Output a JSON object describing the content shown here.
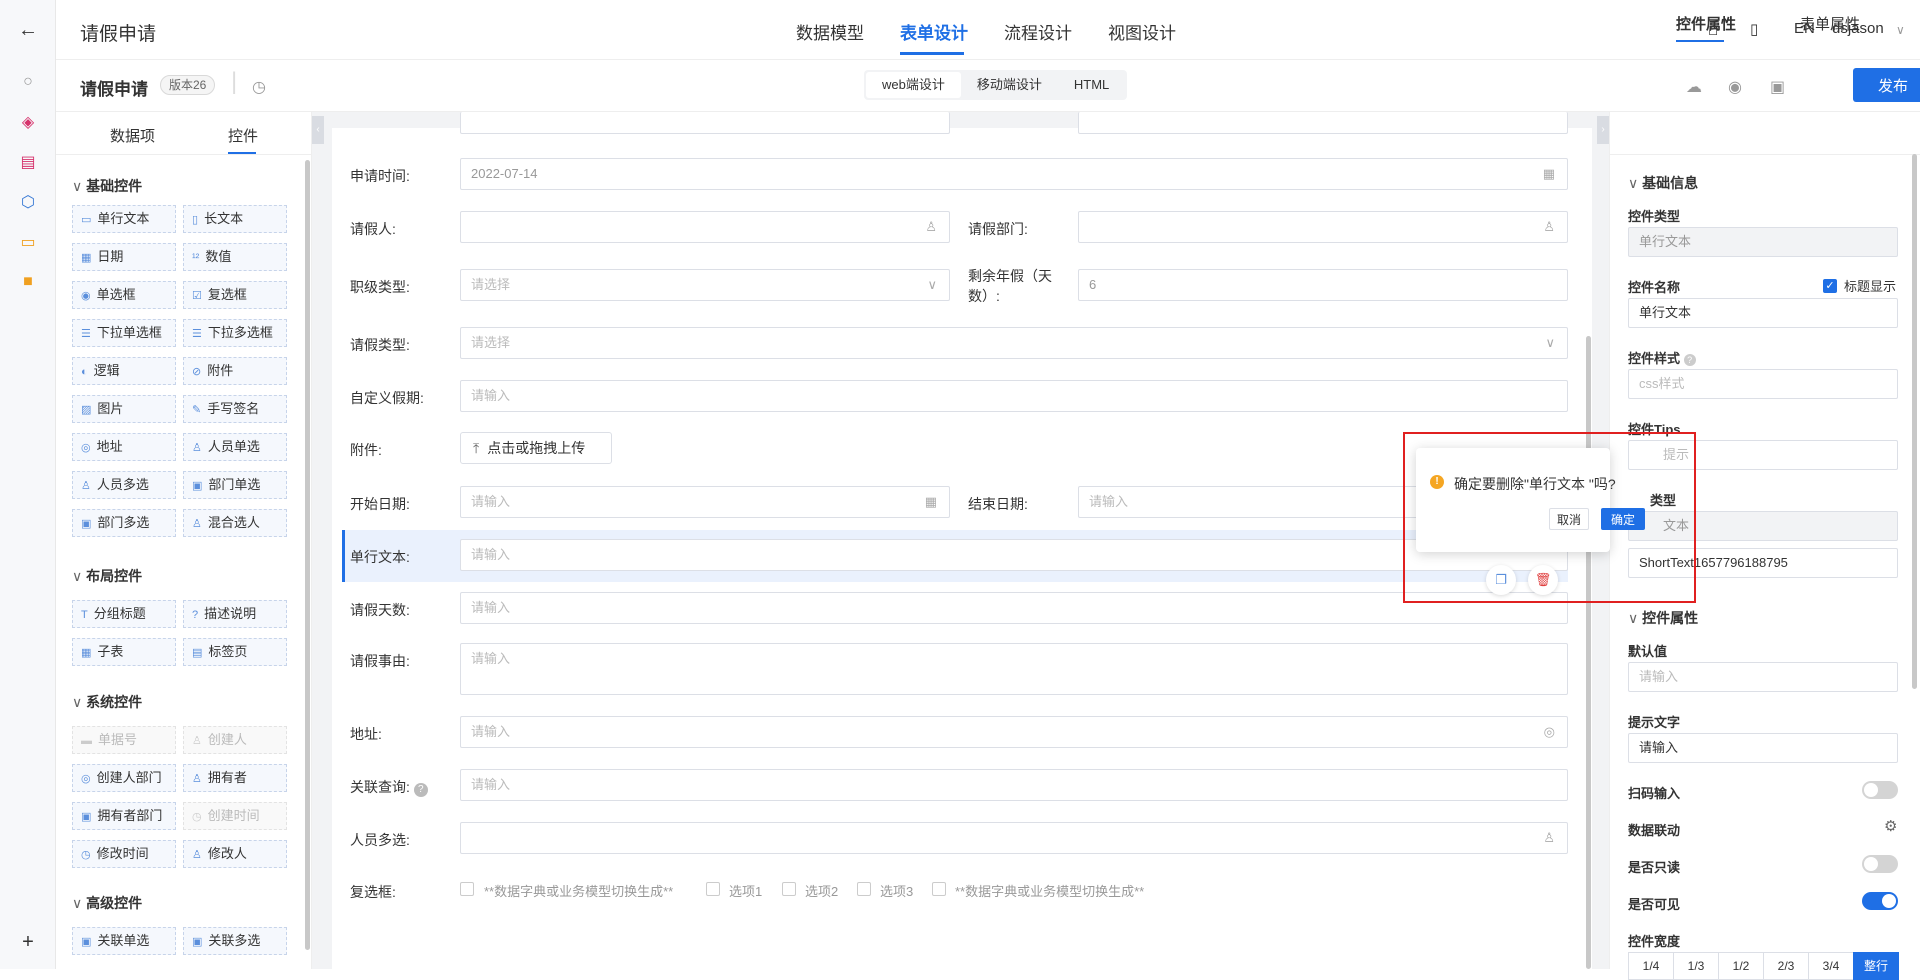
{
  "topbar": {
    "app_title": "请假申请",
    "tabs": [
      "数据模型",
      "表单设计",
      "流程设计",
      "视图设计"
    ],
    "active_tab": "表单设计",
    "lang": "EN",
    "user": "dsjason"
  },
  "secbar": {
    "form_name": "请假申请",
    "version": "版本26",
    "modes": [
      "web端设计",
      "移动端设计",
      "HTML"
    ],
    "publish": "发布"
  },
  "left": {
    "tabs": [
      "数据项",
      "控件"
    ],
    "groups": {
      "basic": {
        "title": "基础控件",
        "items": [
          "单行文本",
          "长文本",
          "日期",
          "数值",
          "单选框",
          "复选框",
          "下拉单选框",
          "下拉多选框",
          "逻辑",
          "附件",
          "图片",
          "手写签名",
          "地址",
          "人员单选",
          "人员多选",
          "部门单选",
          "部门多选",
          "混合选人"
        ]
      },
      "layout": {
        "title": "布局控件",
        "items": [
          "分组标题",
          "描述说明",
          "子表",
          "标签页"
        ]
      },
      "system": {
        "title": "系统控件",
        "items": [
          "单据号",
          "创建人",
          "创建人部门",
          "拥有者",
          "拥有者部门",
          "创建时间",
          "修改时间",
          "修改人"
        ]
      },
      "advanced": {
        "title": "高级控件",
        "items": [
          "关联单选",
          "关联多选"
        ]
      }
    }
  },
  "form": {
    "apply_time": {
      "label": "申请时间:",
      "value": "2022-07-14"
    },
    "applicant": {
      "label": "请假人:"
    },
    "dept": {
      "label": "请假部门:"
    },
    "rank": {
      "label": "职级类型:",
      "placeholder": "请选择"
    },
    "annual_left": {
      "label": "剩余年假（天数）:",
      "value": "6"
    },
    "leave_type": {
      "label": "请假类型:",
      "placeholder": "请选择"
    },
    "custom_leave": {
      "label": "自定义假期:",
      "placeholder": "请输入"
    },
    "attachment": {
      "label": "附件:",
      "button": "点击或拖拽上传"
    },
    "start_date": {
      "label": "开始日期:",
      "placeholder": "请输入"
    },
    "end_date": {
      "label": "结束日期:",
      "placeholder": "请输入"
    },
    "short_text": {
      "label": "单行文本:",
      "placeholder": "请输入"
    },
    "days": {
      "label": "请假天数:",
      "placeholder": "请输入"
    },
    "reason": {
      "label": "请假事由:",
      "placeholder": "请输入"
    },
    "address": {
      "label": "地址:",
      "placeholder": "请输入"
    },
    "relation": {
      "label": "关联查询:",
      "placeholder": "请输入"
    },
    "people": {
      "label": "人员多选:"
    },
    "checkbox": {
      "label": "复选框:",
      "options": [
        "**数据字典或业务模型切换生成**",
        "选项1",
        "选项2",
        "选项3",
        "**数据字典或业务模型切换生成**"
      ]
    }
  },
  "popconfirm": {
    "message": "确定要删除\"单行文本 \"吗?",
    "cancel": "取消",
    "ok": "确定"
  },
  "right": {
    "tabs": [
      "控件属性",
      "表单属性"
    ],
    "basic_section": "基础信息",
    "ctrl_type_label": "控件类型",
    "ctrl_type_value": "单行文本",
    "ctrl_name_label": "控件名称",
    "show_title_label": "标题显示",
    "ctrl_name_value": "单行文本",
    "ctrl_style_label": "控件样式",
    "ctrl_style_placeholder": "css样式",
    "ctrl_tips_label": "控件Tips",
    "ctrl_tips_placeholder": "提示",
    "data_type_label": "类型",
    "data_type_value": "文本",
    "code_value": "ShortText1657796188795",
    "prop_section": "控件属性",
    "default_label": "默认值",
    "default_placeholder": "请输入",
    "hint_label": "提示文字",
    "hint_value": "请输入",
    "scan_label": "扫码输入",
    "link_label": "数据联动",
    "readonly_label": "是否只读",
    "visible_label": "是否可见",
    "width_label": "控件宽度",
    "width_options": [
      "1/4",
      "1/3",
      "1/2",
      "2/3",
      "3/4",
      "整行"
    ]
  }
}
